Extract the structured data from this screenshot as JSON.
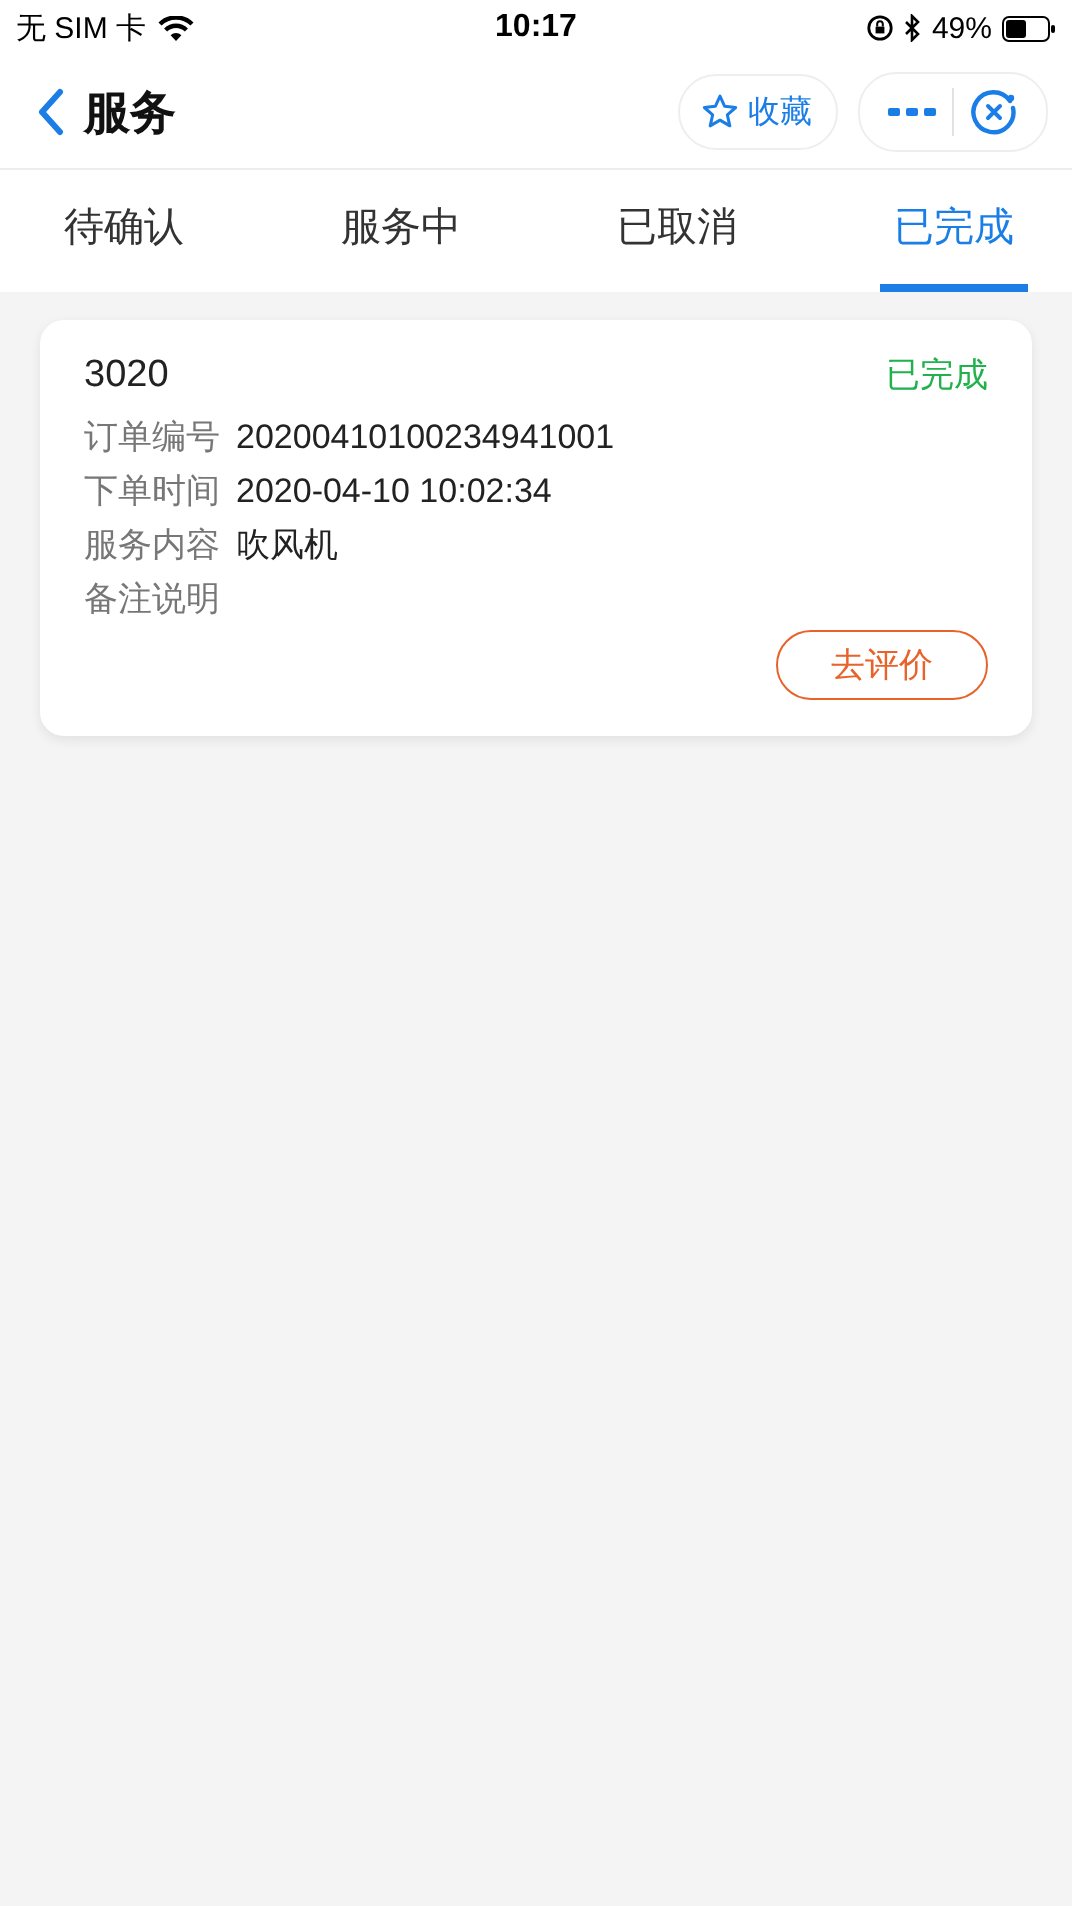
{
  "status_bar": {
    "carrier": "无 SIM 卡",
    "time": "10:17",
    "battery": "49%"
  },
  "nav": {
    "title": "服务",
    "favorite": "收藏"
  },
  "tabs": [
    {
      "label": "待确认",
      "selected": false
    },
    {
      "label": "服务中",
      "selected": false
    },
    {
      "label": "已取消",
      "selected": false
    },
    {
      "label": "已完成",
      "selected": true
    }
  ],
  "orders": [
    {
      "title": "3020",
      "status": "已完成",
      "fields": [
        {
          "label": "订单编号",
          "value": "20200410100234941001"
        },
        {
          "label": "下单时间",
          "value": "2020-04-10 10:02:34"
        },
        {
          "label": "服务内容",
          "value": "吹风机"
        },
        {
          "label": "备注说明"
        }
      ],
      "action": "去评价"
    }
  ]
}
